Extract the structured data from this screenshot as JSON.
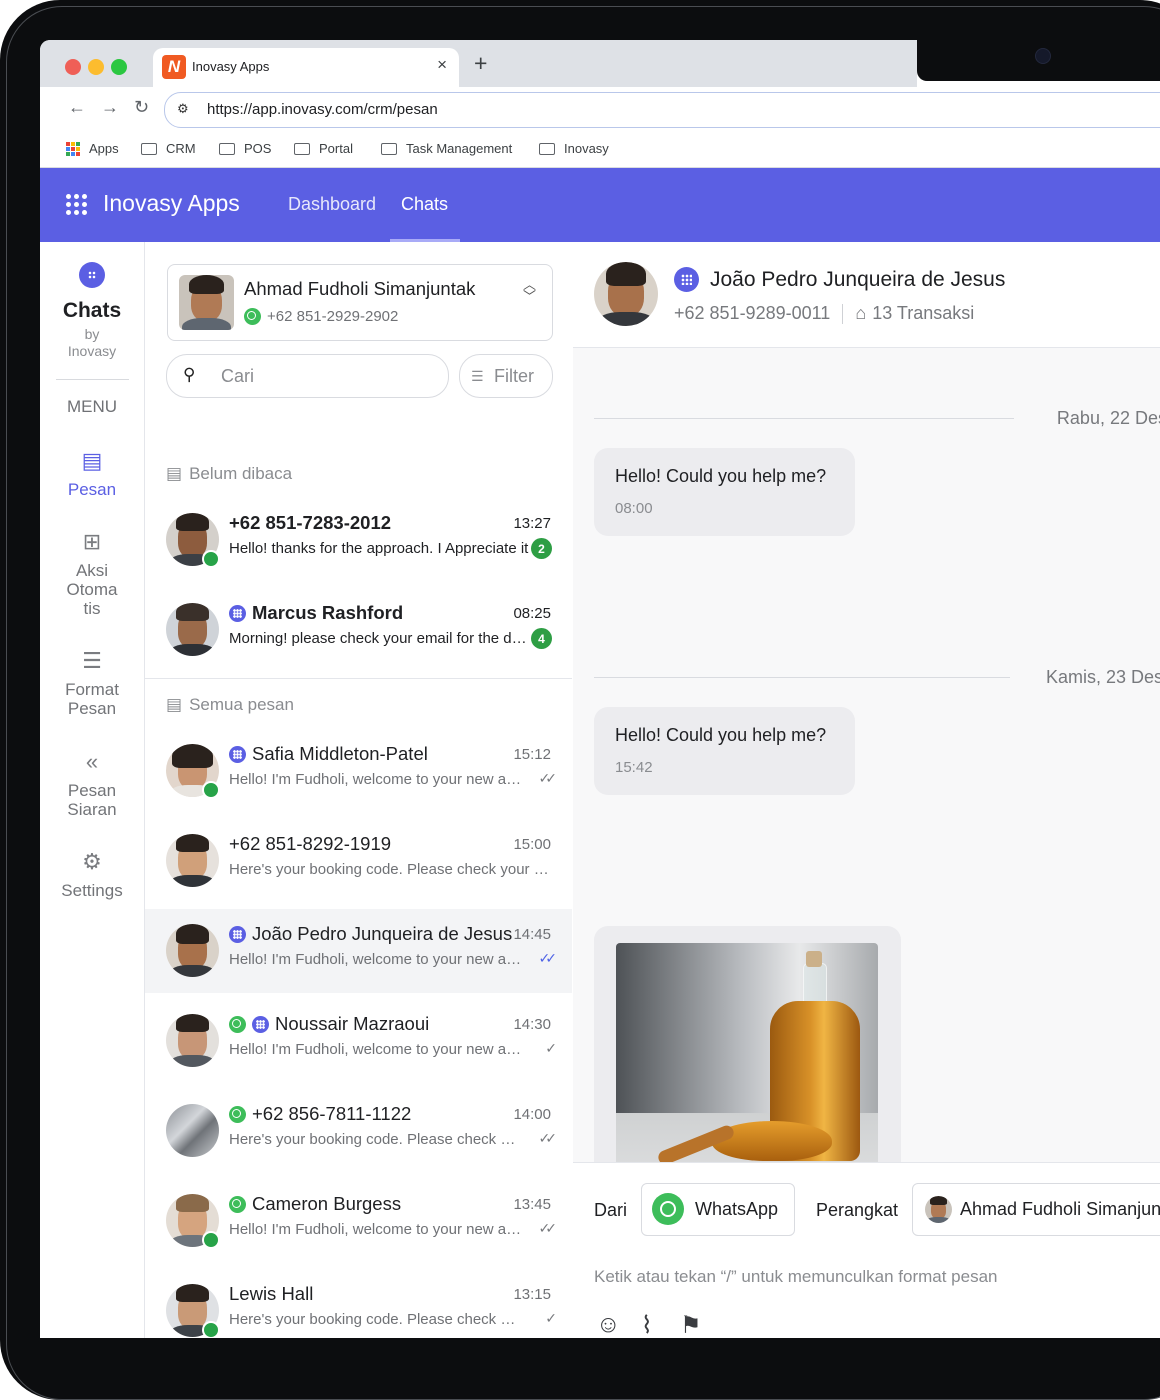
{
  "browser": {
    "tab_title": "Inovasy Apps",
    "url": "https://app.inovasy.com/crm/pesan",
    "bookmarks": [
      "Apps",
      "CRM",
      "POS",
      "Portal",
      "Task Management",
      "Inovasy"
    ]
  },
  "header": {
    "app_name": "Inovasy Apps",
    "nav": [
      "Dashboard",
      "Chats"
    ],
    "active_nav": "Chats"
  },
  "sidebar": {
    "brand_title": "Chats",
    "brand_by": "by",
    "brand_org": "Inovasy",
    "menu_label": "MENU",
    "items": [
      {
        "label": "Pesan",
        "icon": "message-icon",
        "active": true
      },
      {
        "label": "Aksi Otomatis",
        "label_lines": [
          "Aksi",
          "Otoma",
          "tis"
        ],
        "icon": "auto-action-icon"
      },
      {
        "label": "Format Pesan",
        "label_lines": [
          "Format",
          "Pesan"
        ],
        "icon": "template-icon"
      },
      {
        "label": "Pesan Siaran",
        "label_lines": [
          "Pesan",
          "Siaran"
        ],
        "icon": "broadcast-icon"
      },
      {
        "label": "Settings",
        "icon": "gear-icon"
      }
    ]
  },
  "account": {
    "name": "Ahmad Fudholi Simanjuntak",
    "phone": "+62 851-2929-2902"
  },
  "search": {
    "placeholder": "Cari",
    "filter_label": "Filter"
  },
  "unread_section": {
    "label": "Belum dibaca",
    "chats": [
      {
        "name": "+62 851-7283-2012",
        "time": "13:27",
        "preview": "Hello! thanks for the approach. I Appreciate it",
        "badge": "2",
        "online": true
      },
      {
        "name": "Marcus Rashford",
        "time": "08:25",
        "preview": "Morning! please check your email for the details",
        "badge": "4",
        "channel": "inovasy"
      }
    ]
  },
  "all_section": {
    "label": "Semua pesan",
    "chats": [
      {
        "name": "Safia Middleton-Patel",
        "time": "15:12",
        "preview": "Hello! I'm Fudholi, welcome to your new account",
        "channel": "inovasy",
        "online": true,
        "status": "delivered"
      },
      {
        "name": "+62 851-8292-1919",
        "time": "15:00",
        "preview": "Here's your booking code. Please check your email",
        "status": "none"
      },
      {
        "name": "João Pedro Junqueira de Jesus",
        "time": "14:45",
        "preview": "Hello! I'm Fudholi, welcome to your new account",
        "channel": "inovasy",
        "status": "read",
        "selected": true
      },
      {
        "name": "Noussair Mazraoui",
        "time": "14:30",
        "preview": "Hello! I'm Fudholi, welcome to your new account",
        "channel": "both",
        "status": "sent"
      },
      {
        "name": "+62 856-7811-1122",
        "time": "14:00",
        "preview": "Here's your booking code. Please check your email",
        "channel": "whatsapp",
        "status": "delivered"
      },
      {
        "name": "Cameron Burgess",
        "time": "13:45",
        "preview": "Hello! I'm Fudholi, welcome to your new account",
        "channel": "whatsapp",
        "online": true,
        "status": "delivered"
      },
      {
        "name": "Lewis Hall",
        "time": "13:15",
        "preview": "Here's your booking code. Please check your email",
        "online": true,
        "status": "sent"
      }
    ]
  },
  "conversation": {
    "contact_name": "João Pedro Junqueira de Jesus",
    "phone": "+62 851-9289-0011",
    "transactions": "13 Transaksi",
    "days": [
      {
        "label": "Rabu, 22 Des",
        "message": "Hello! Could you help me?",
        "time": "08:00"
      },
      {
        "label": "Kamis, 23 Des",
        "message": "Hello! Could you help me?",
        "time": "15:42"
      }
    ]
  },
  "composer": {
    "from_label": "Dari",
    "channel": "WhatsApp",
    "device_label": "Perangkat",
    "device": "Ahmad Fudholi Simanjuntak",
    "placeholder": "Ketik atau tekan “/” untuk memunculkan format pesan"
  },
  "colors": {
    "brand": "#5b5fe3",
    "whatsapp": "#3dbd5a",
    "badge": "#2e9e44",
    "read_tick": "#4f63e6"
  }
}
